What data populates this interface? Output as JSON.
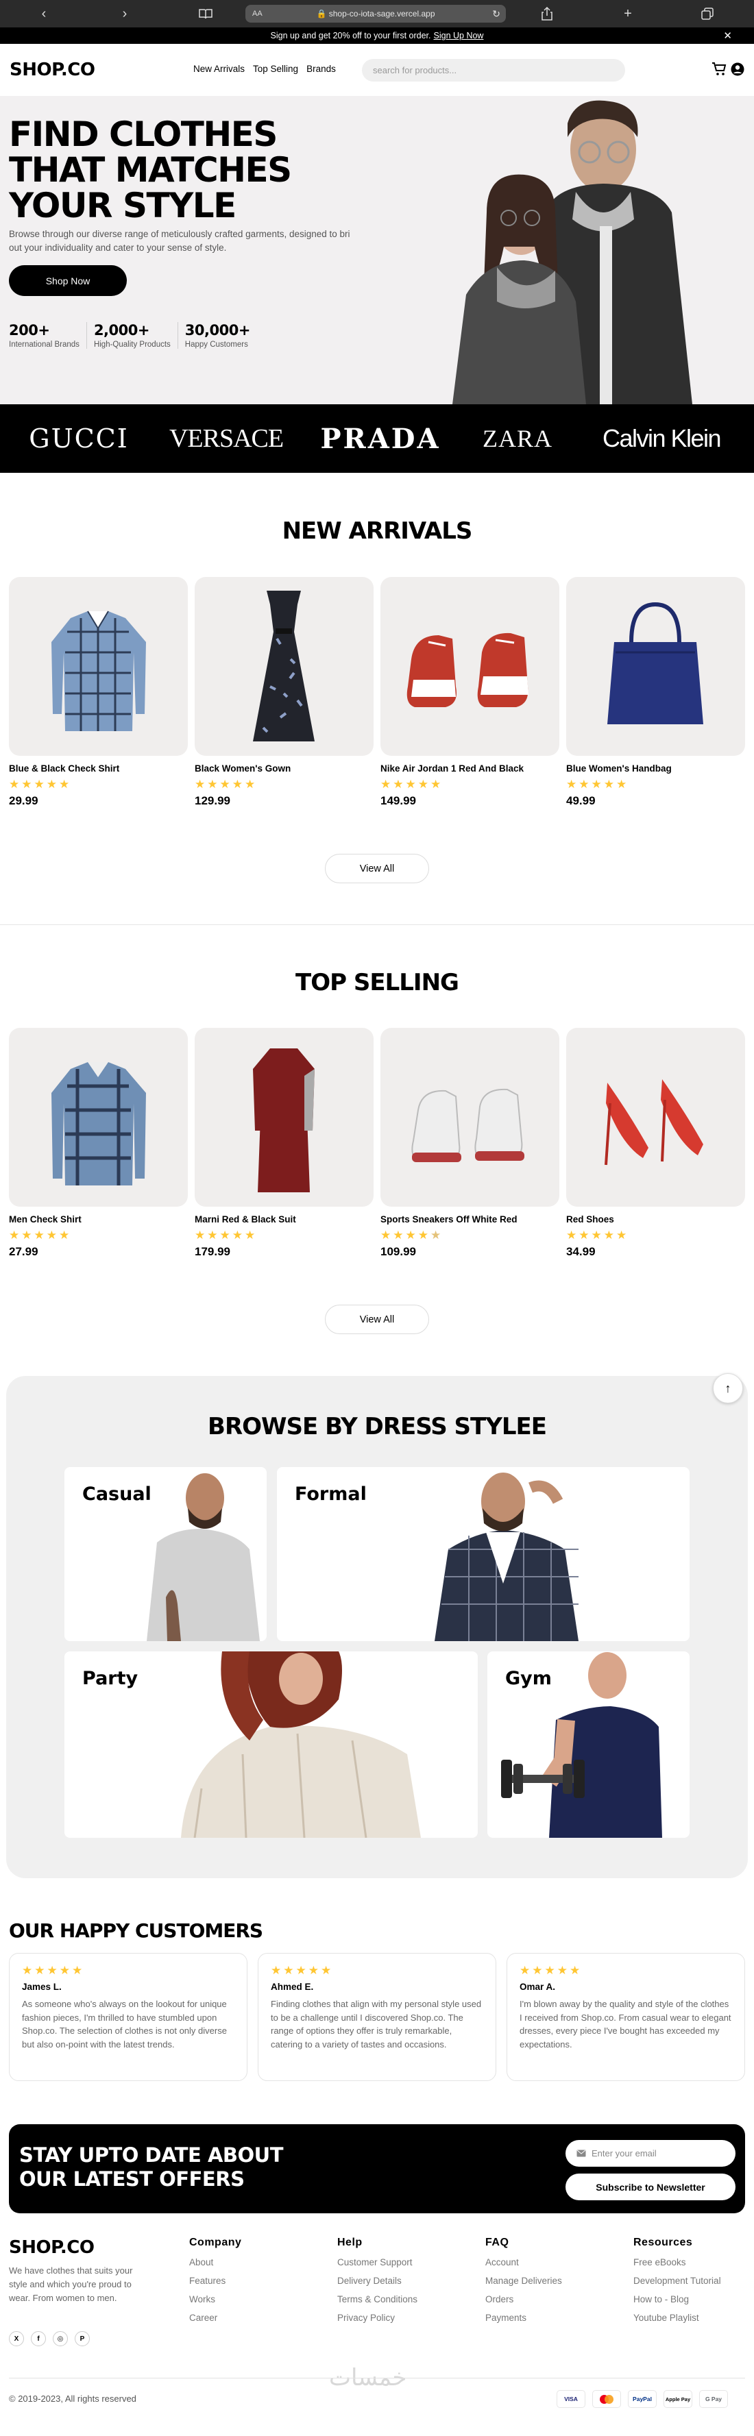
{
  "browser": {
    "text_size": "AA",
    "url": "shop-co-iota-sage.vercel.app"
  },
  "promo": {
    "text": "Sign up and get 20% off to your first order.",
    "link": "Sign Up Now"
  },
  "header": {
    "logo": "SHOP.CO",
    "nav": [
      "New Arrivals",
      "Top Selling",
      "Brands"
    ],
    "search_placeholder": "search for products..."
  },
  "hero": {
    "title": "FIND CLOTHES THAT MATCHES YOUR STYLE",
    "subtitle": "Browse through our diverse range of meticulously crafted garments, designed to bring out your individuality and cater to your sense of style.",
    "cta": "Shop Now",
    "stats": [
      {
        "value": "200+",
        "label": "International Brands"
      },
      {
        "value": "2,000+",
        "label": "High-Quality Products"
      },
      {
        "value": "30,000+",
        "label": "Happy Customers"
      }
    ]
  },
  "brands": [
    "GUCCI",
    "VERSACE",
    "PRADA",
    "ZARA",
    "Calvin Klein"
  ],
  "new_arrivals": {
    "title": "NEW ARRIVALS",
    "products": [
      {
        "name": "Blue & Black Check Shirt",
        "price": "29.99",
        "rating": 5
      },
      {
        "name": "Black Women's Gown",
        "price": "129.99",
        "rating": 5
      },
      {
        "name": "Nike Air Jordan 1 Red And Black",
        "price": "149.99",
        "rating": 5
      },
      {
        "name": "Blue Women's Handbag",
        "price": "49.99",
        "rating": 5
      }
    ],
    "view_all": "View All"
  },
  "top_selling": {
    "title": "TOP SELLING",
    "products": [
      {
        "name": "Men Check Shirt",
        "price": "27.99",
        "rating": 5
      },
      {
        "name": "Marni Red & Black Suit",
        "price": "179.99",
        "rating": 5
      },
      {
        "name": "Sports Sneakers Off White Red",
        "price": "109.99",
        "rating": 4.5
      },
      {
        "name": "Red Shoes",
        "price": "34.99",
        "rating": 5
      }
    ],
    "view_all": "View All"
  },
  "browse": {
    "title": "BROWSE BY DRESS STYLEE",
    "styles": [
      "Casual",
      "Formal",
      "Party",
      "Gym"
    ]
  },
  "reviews": {
    "title": "OUR HAPPY CUSTOMERS",
    "items": [
      {
        "name": "James L.",
        "rating": 5,
        "text": "As someone who's always on the lookout for unique fashion pieces, I'm thrilled to have stumbled upon Shop.co. The selection of clothes is not only diverse but also on-point with the latest trends."
      },
      {
        "name": "Ahmed E.",
        "rating": 5,
        "text": "Finding clothes that align with my personal style used to be a challenge until I discovered Shop.co. The range of options they offer is truly remarkable, catering to a variety of tastes and occasions."
      },
      {
        "name": "Omar A.",
        "rating": 5,
        "text": "I'm blown away by the quality and style of the clothes I received from Shop.co. From casual wear to elegant dresses, every piece I've bought has exceeded my expectations."
      }
    ]
  },
  "newsletter": {
    "title_line1": "STAY UPTO DATE ABOUT",
    "title_line2": "OUR LATEST OFFERS",
    "placeholder": "Enter your email",
    "button": "Subscribe to Newsletter"
  },
  "footer": {
    "logo": "SHOP.CO",
    "description": "We have clothes that suits your style and which you're proud to wear. From women to men.",
    "columns": [
      {
        "heading": "Company",
        "links": [
          "About",
          "Features",
          "Works",
          "Career"
        ]
      },
      {
        "heading": "Help",
        "links": [
          "Customer Support",
          "Delivery Details",
          "Terms & Conditions",
          "Privacy Policy"
        ]
      },
      {
        "heading": "FAQ",
        "links": [
          "Account",
          "Manage Deliveries",
          "Orders",
          "Payments"
        ]
      },
      {
        "heading": "Resources",
        "links": [
          "Free eBooks",
          "Development Tutorial",
          "How to - Blog",
          "Youtube Playlist"
        ]
      }
    ],
    "copyright": "© 2019-2023, All rights reserved",
    "watermark": "خمسات",
    "payments": [
      "VISA",
      "Mastercard",
      "PayPal",
      "Apple Pay",
      "G Pay"
    ]
  },
  "colors": {
    "star": "#ffc633",
    "black": "#000000",
    "bg_soft": "#f0f0f0"
  }
}
